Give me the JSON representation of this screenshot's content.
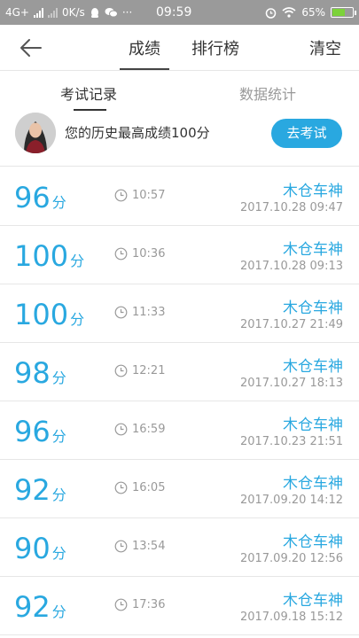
{
  "status_bar": {
    "network": "4G+",
    "speed": "0K/s",
    "more": "···",
    "time": "09:59",
    "battery": "65%",
    "battery_level": 0.65
  },
  "header": {
    "tabs": [
      "成绩",
      "排行榜"
    ],
    "active_tab": 0,
    "clear_label": "清空"
  },
  "subtabs": {
    "items": [
      "考试记录",
      "数据统计"
    ],
    "active": 0
  },
  "banner": {
    "best_text": "您的历史最高成绩100分",
    "button_label": "去考试"
  },
  "score_unit": "分",
  "records": [
    {
      "score": "96",
      "duration": "10:57",
      "name": "木仓车神",
      "datetime": "2017.10.28  09:47"
    },
    {
      "score": "100",
      "duration": "10:36",
      "name": "木仓车神",
      "datetime": "2017.10.28  09:13"
    },
    {
      "score": "100",
      "duration": "11:33",
      "name": "木仓车神",
      "datetime": "2017.10.27  21:49"
    },
    {
      "score": "98",
      "duration": "12:21",
      "name": "木仓车神",
      "datetime": "2017.10.27  18:13"
    },
    {
      "score": "96",
      "duration": "16:59",
      "name": "木仓车神",
      "datetime": "2017.10.23  21:51"
    },
    {
      "score": "92",
      "duration": "16:05",
      "name": "木仓车神",
      "datetime": "2017.09.20  14:12"
    },
    {
      "score": "90",
      "duration": "13:54",
      "name": "木仓车神",
      "datetime": "2017.09.20  12:56"
    },
    {
      "score": "92",
      "duration": "17:36",
      "name": "木仓车神",
      "datetime": "2017.09.18  15:12"
    }
  ],
  "colors": {
    "accent": "#29a8e0",
    "status_bar": "#9a9a9a",
    "muted_text": "#999999"
  }
}
